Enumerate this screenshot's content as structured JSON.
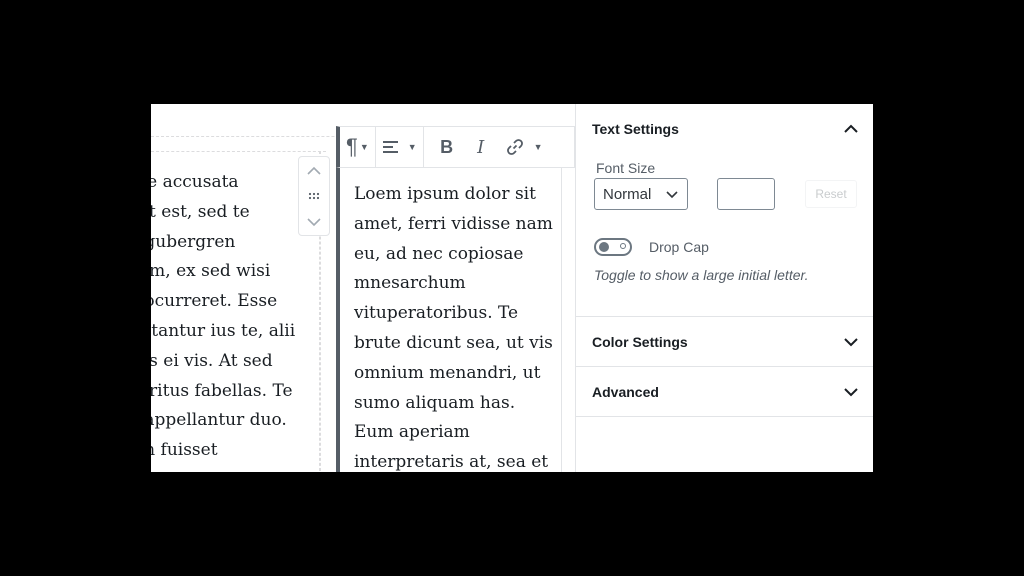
{
  "editor": {
    "left_column_lines": [
      "re accusata",
      "et est, sed te",
      " gubergren",
      "am, ex sed wisi",
      " ocurreret. Esse",
      "ittantur ius te, alii",
      "as ei vis. At sed",
      "eritus fabellas. Te",
      " appellantur duo.",
      "m fuisset"
    ],
    "selected_block_text": "Loem ipsum dolor sit amet, ferri vidisse nam eu, ad nec copiosae mnesarchum vituperatoribus. Te brute dicunt sea, ut vis omnium menandri, ut sumo aliquam has. Eum aperiam interpretaris at, sea et",
    "toolbar": {
      "paragraph_icon": "paragraph-icon",
      "align_icon": "align-left-icon",
      "bold_label": "B",
      "italic_label": "I",
      "link_icon": "link-icon"
    },
    "mover": {
      "up_icon": "chevron-up-icon",
      "drag_icon": "drag-handle-icon",
      "down_icon": "chevron-down-icon"
    }
  },
  "sidebar": {
    "text_settings": {
      "title": "Text Settings",
      "font_size_label": "Font Size",
      "font_size_value": "Normal",
      "custom_size_value": "",
      "reset_label": "Reset",
      "drop_cap_label": "Drop Cap",
      "drop_cap_on": false,
      "help_text": "Toggle to show a large initial letter."
    },
    "color_settings": {
      "title": "Color Settings"
    },
    "advanced": {
      "title": "Advanced"
    }
  }
}
